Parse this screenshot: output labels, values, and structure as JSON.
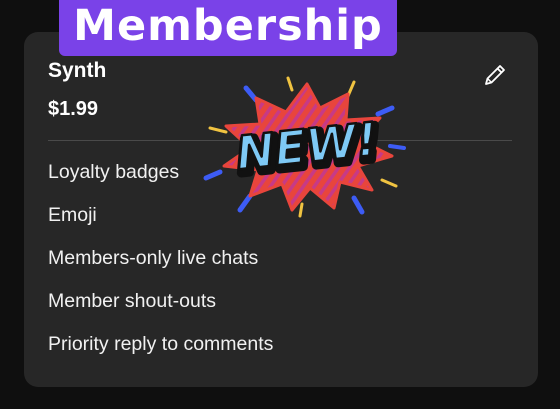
{
  "header": {
    "title": "Membership"
  },
  "tier": {
    "name": "Synth",
    "price": "$1.99"
  },
  "perks": [
    "Loyalty badges",
    "Emoji",
    "Members-only live chats",
    "Member shout-outs",
    "Priority reply to comments"
  ],
  "sticker": {
    "text": "NEW!"
  },
  "icons": {
    "edit": "pencil-icon"
  },
  "colors": {
    "background": "#0f0f0f",
    "card": "#272727",
    "accent": "#7a42e8",
    "sticker_burst": "#e8453c",
    "sticker_text": "#7ec9f5"
  }
}
